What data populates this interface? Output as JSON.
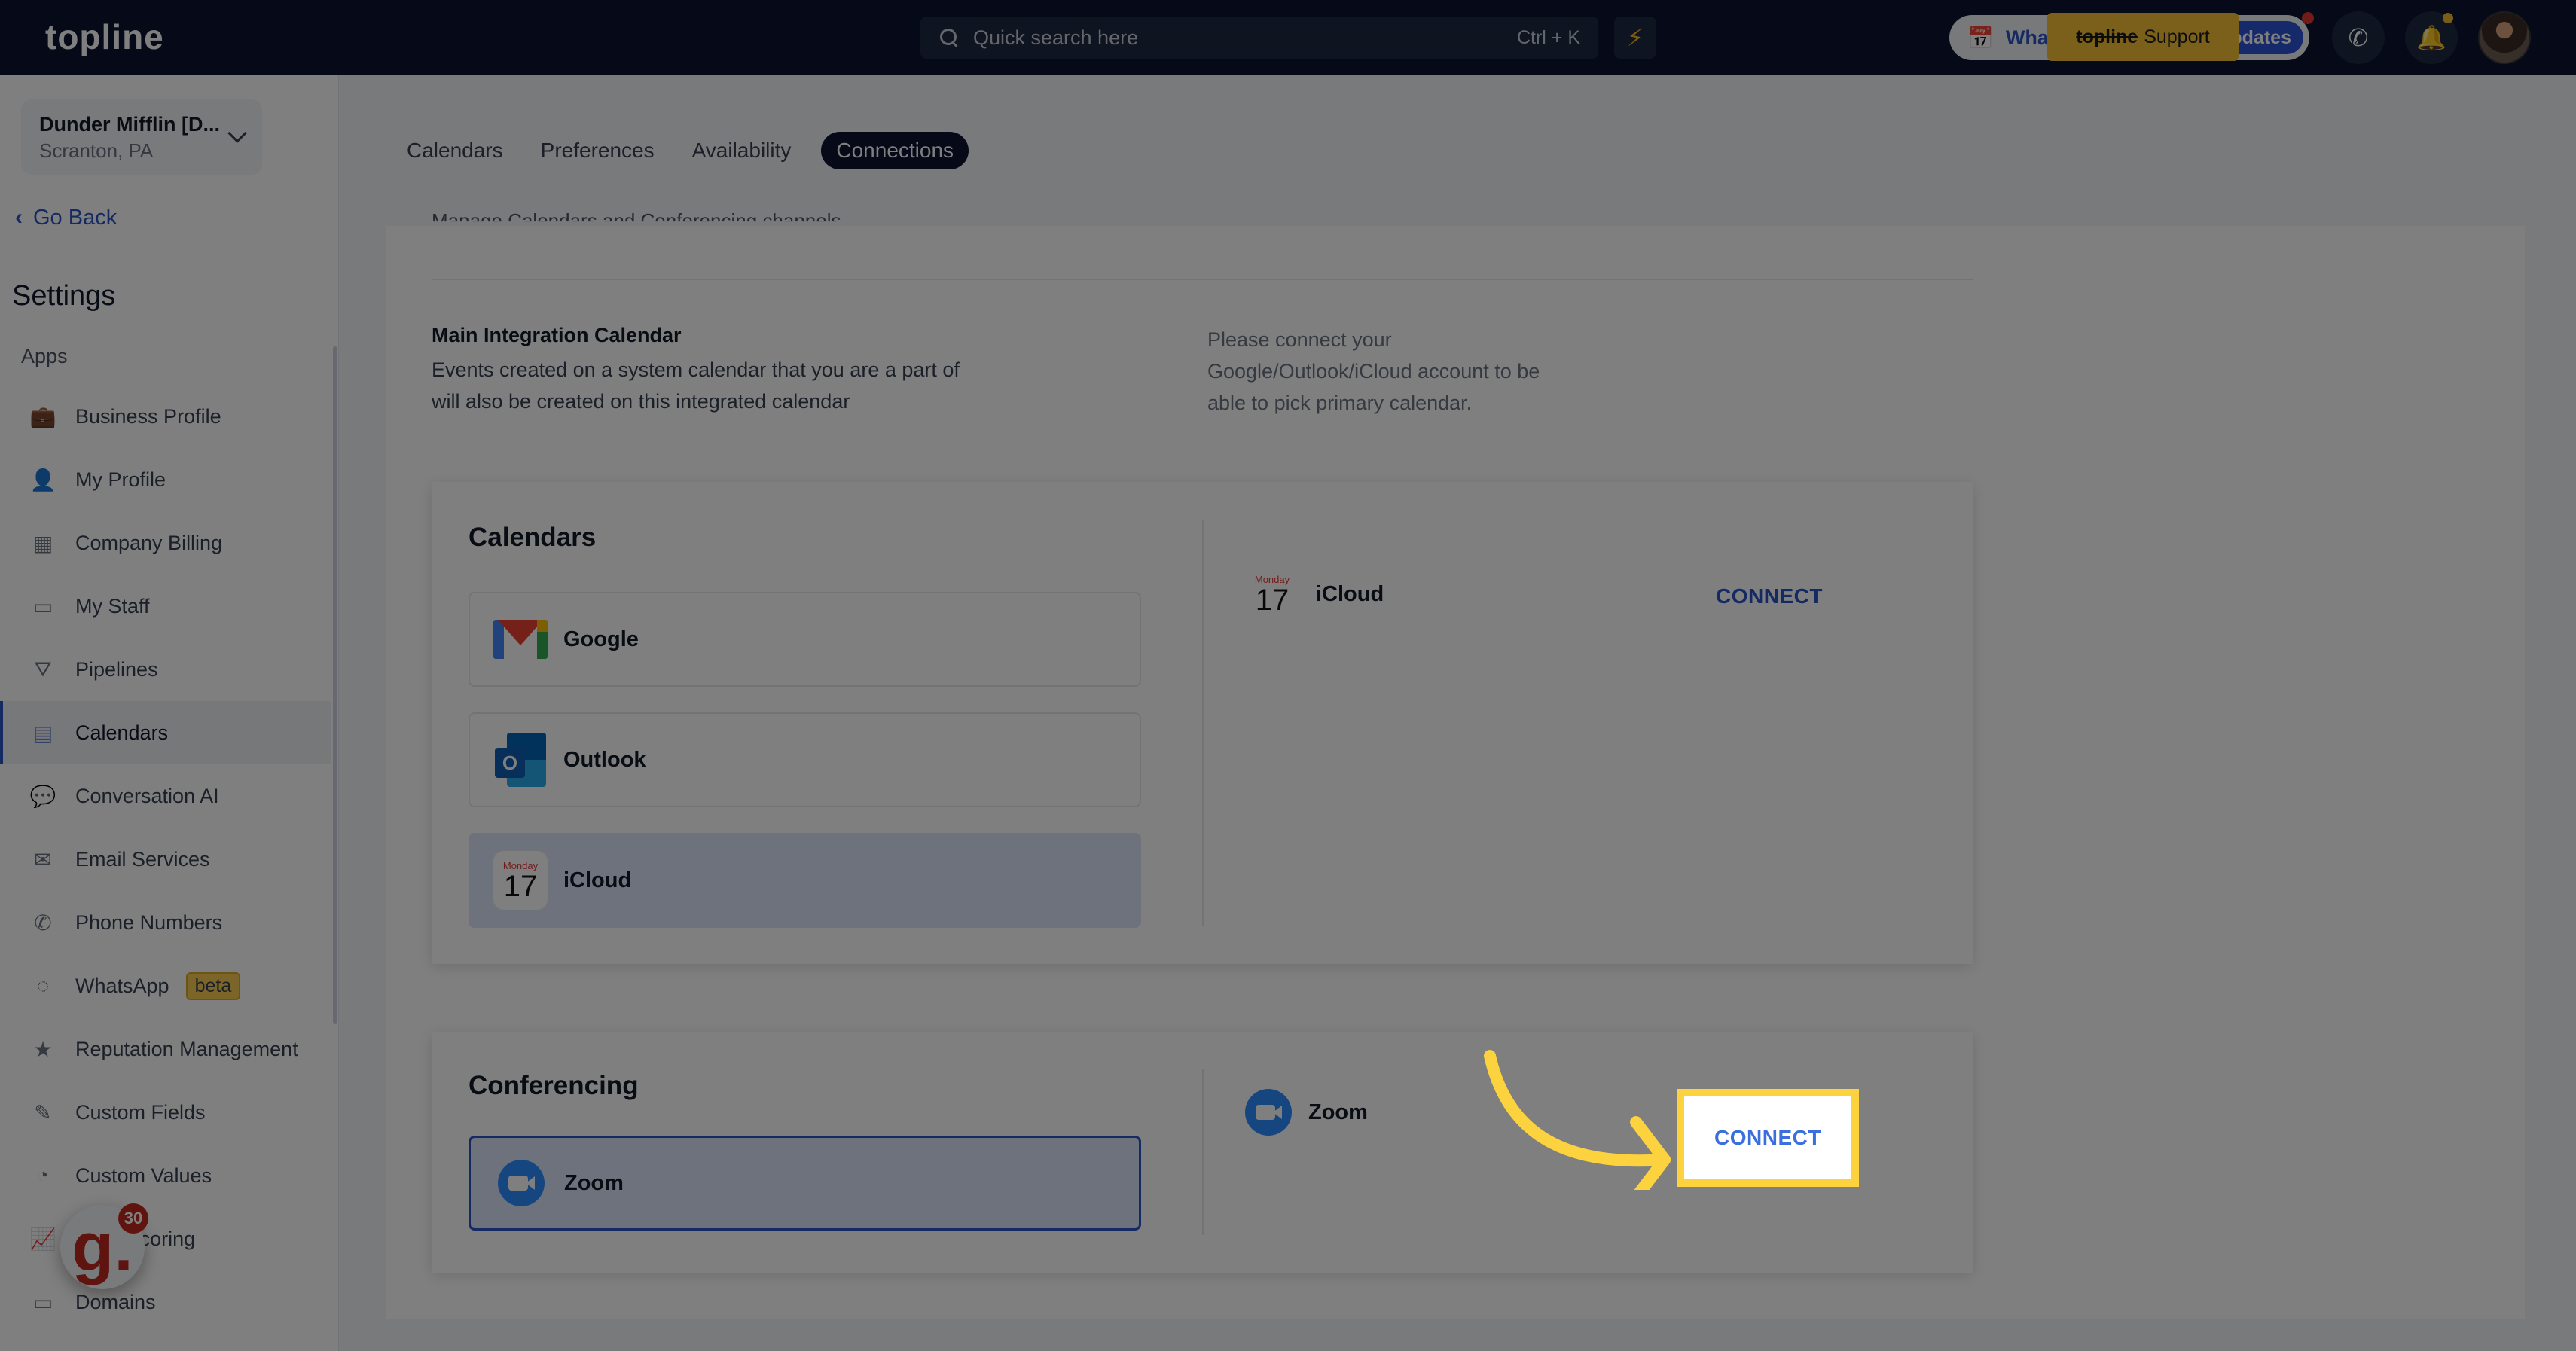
{
  "topbar": {
    "logo": "topline",
    "search_placeholder": "Quick search here",
    "search_shortcut": "Ctrl + K",
    "whats_new_label": "What's New",
    "updates_label": "Updates",
    "support_tooltip_brand": "topline",
    "support_tooltip_label": "Support",
    "icons": {
      "search": "search-icon",
      "bolt": "lightning-icon",
      "whats_new": "calendar-megaphone-icon",
      "phone": "phone-icon",
      "bell": "bell-icon"
    }
  },
  "sidebar": {
    "location": {
      "name": "Dunder Mifflin [D...",
      "sub": "Scranton, PA"
    },
    "go_back": "Go Back",
    "title": "Settings",
    "section": "Apps",
    "items": [
      {
        "label": "Business Profile",
        "icon": "briefcase-icon",
        "glyph": "💼"
      },
      {
        "label": "My Profile",
        "icon": "person-icon",
        "glyph": "👤"
      },
      {
        "label": "Company Billing",
        "icon": "calculator-icon",
        "glyph": "▦"
      },
      {
        "label": "My Staff",
        "icon": "inbox-icon",
        "glyph": "▭"
      },
      {
        "label": "Pipelines",
        "icon": "filter-list-icon",
        "glyph": "⛛"
      },
      {
        "label": "Calendars",
        "icon": "calendar-icon",
        "glyph": "▤",
        "active": true
      },
      {
        "label": "Conversation AI",
        "icon": "chat-bubbles-icon",
        "glyph": "💬"
      },
      {
        "label": "Email Services",
        "icon": "envelope-icon",
        "glyph": "✉"
      },
      {
        "label": "Phone Numbers",
        "icon": "phone-icon",
        "glyph": "✆"
      },
      {
        "label": "WhatsApp",
        "icon": "whatsapp-icon",
        "glyph": "◌",
        "badge": "beta"
      },
      {
        "label": "Reputation Management",
        "icon": "star-sparkle-icon",
        "glyph": "★"
      },
      {
        "label": "Custom Fields",
        "icon": "edit-field-icon",
        "glyph": "✎"
      },
      {
        "label": "Custom Values",
        "icon": "pie-chart-icon",
        "glyph": "◔"
      },
      {
        "label": "Lead Scoring",
        "icon": "trend-chart-icon",
        "glyph": "📈"
      },
      {
        "label": "Domains",
        "icon": "browser-window-icon",
        "glyph": "▭"
      }
    ],
    "widget": {
      "letter": "g.",
      "badge": "30"
    }
  },
  "tabs": [
    {
      "label": "Calendars",
      "active": false
    },
    {
      "label": "Preferences",
      "active": false
    },
    {
      "label": "Availability",
      "active": false
    },
    {
      "label": "Connections",
      "active": true
    }
  ],
  "main": {
    "subtitle": "Manage Calendars and Conferencing channels",
    "integration": {
      "title": "Main Integration Calendar",
      "description": "Events created on a system calendar that you are a part of will also be created on this integrated calendar",
      "hint": "Please connect your Google/Outlook/iCloud account to be able to pick primary calendar."
    },
    "calendars": {
      "title": "Calendars",
      "providers": [
        {
          "label": "Google",
          "icon": "gmail-icon"
        },
        {
          "label": "Outlook",
          "icon": "outlook-icon"
        },
        {
          "label": "iCloud",
          "icon": "icloud-calendar-icon",
          "selected": true
        }
      ],
      "detail": {
        "label": "iCloud",
        "cal_day": "Monday",
        "cal_num": "17",
        "connect_label": "CONNECT"
      }
    },
    "conferencing": {
      "title": "Conferencing",
      "providers": [
        {
          "label": "Zoom",
          "icon": "zoom-icon",
          "selected": true
        }
      ],
      "detail": {
        "label": "Zoom",
        "connect_label": "CONNECT"
      }
    }
  },
  "colors": {
    "accent": "#2b52c7",
    "topbar": "#0b1330",
    "highlight": "#fdd23f",
    "beta_badge": "#f6cb52"
  }
}
